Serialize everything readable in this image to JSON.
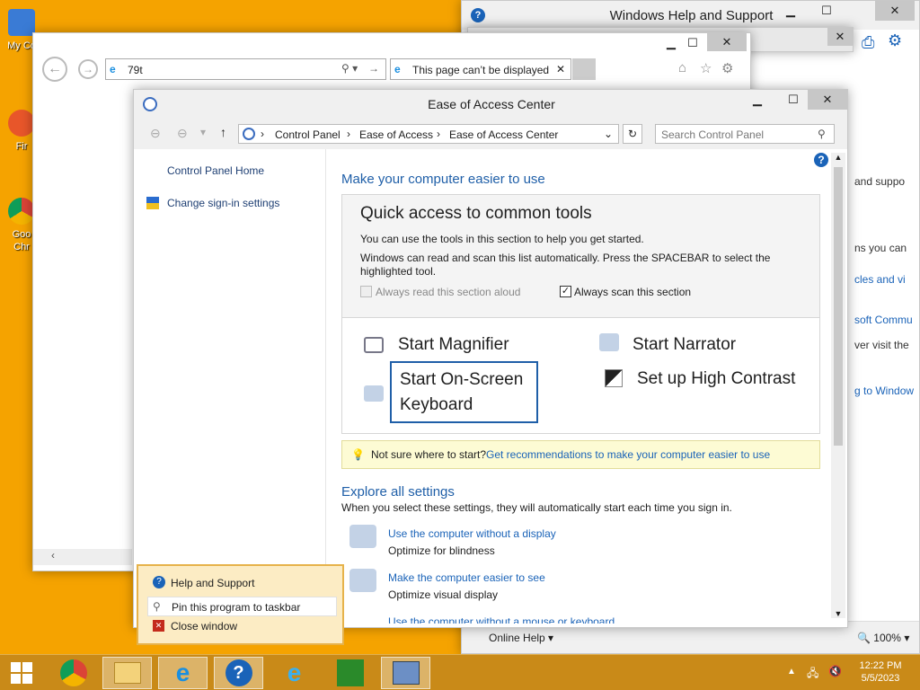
{
  "desktop": {
    "icons": [
      {
        "label": "My Co"
      },
      {
        "label": "Fir"
      },
      {
        "label": "Goo"
      },
      {
        "label": "Chr"
      }
    ]
  },
  "help_window": {
    "title": "Windows Help and Support",
    "side_texts": [
      "and suppo",
      "ns you can",
      "cles and vi",
      "soft Commu",
      "ver visit the",
      "g to Window"
    ],
    "online_help": "Online Help",
    "zoom": "100%"
  },
  "ie_window": {
    "address": "79t",
    "tab_title": "This page can’t be displayed"
  },
  "eoa": {
    "title": "Ease of Access Center",
    "breadcrumb": [
      "Control Panel",
      "Ease of Access",
      "Ease of Access Center"
    ],
    "search_placeholder": "Search Control Panel",
    "sidebar": {
      "home": "Control Panel Home",
      "signin": "Change sign-in settings"
    },
    "heading": "Make your computer easier to use",
    "quick": {
      "title": "Quick access to common tools",
      "desc1": "You can use the tools in this section to help you get started.",
      "desc2": "Windows can read and scan this list automatically.  Press the SPACEBAR to select the highlighted tool.",
      "read_aloud": "Always read this section aloud",
      "scan": "Always scan this section",
      "magnifier": "Start Magnifier",
      "narrator": "Start Narrator",
      "osk_line1": "Start On-Screen",
      "osk_line2": "Keyboard",
      "contrast": "Set up High Contrast"
    },
    "hint": {
      "prefix": "Not sure where to start?",
      "link": "Get recommendations to make your computer easier to use"
    },
    "explore": {
      "title": "Explore all settings",
      "desc": "When you select these settings, they will automatically start each time you sign in.",
      "items": [
        {
          "link": "Use the computer without a display",
          "sub": "Optimize for blindness"
        },
        {
          "link": "Make the computer easier to see",
          "sub": "Optimize visual display"
        },
        {
          "link": "Use the computer without a mouse or keyboard",
          "sub": ""
        }
      ]
    }
  },
  "jumplist": {
    "items": [
      "Help and Support",
      "Pin this program to taskbar",
      "Close window"
    ]
  },
  "taskbar": {
    "time": "12:22 PM",
    "date": "5/5/2023"
  },
  "colors": {
    "desktop": "#f5a300",
    "taskbar": "#c98a18",
    "link": "#1a63b8",
    "heading": "#1f5fa8"
  }
}
